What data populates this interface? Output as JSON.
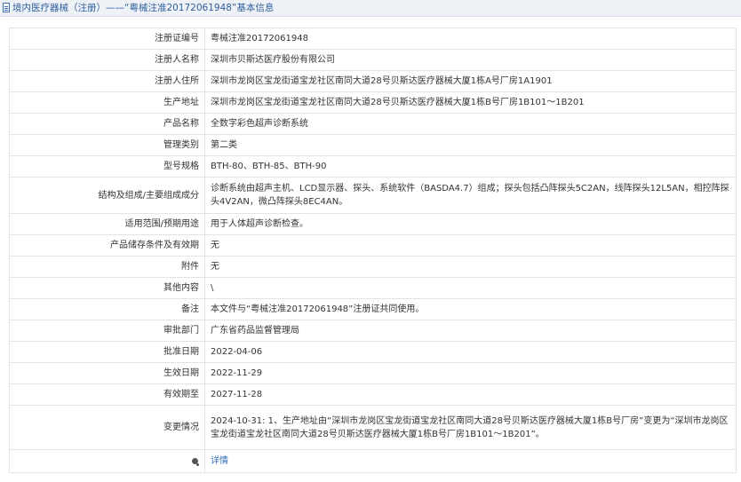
{
  "header": {
    "title": "境内医疗器械（注册）——“粤械注准20172061948”基本信息"
  },
  "rows": [
    {
      "label": "注册证编号",
      "value": "粤械注准20172061948"
    },
    {
      "label": "注册人名称",
      "value": "深圳市贝斯达医疗股份有限公司"
    },
    {
      "label": "注册人住所",
      "value": "深圳市龙岗区宝龙街道宝龙社区南同大道28号贝斯达医疗器械大厦1栋A号厂房1A1901"
    },
    {
      "label": "生产地址",
      "value": "深圳市龙岗区宝龙街道宝龙社区南同大道28号贝斯达医疗器械大厦1栋B号厂房1B101～1B201"
    },
    {
      "label": "产品名称",
      "value": "全数字彩色超声诊断系统"
    },
    {
      "label": "管理类别",
      "value": "第二类"
    },
    {
      "label": "型号规格",
      "value": "BTH-80、BTH-85、BTH-90"
    },
    {
      "label": "结构及组成/主要组成成分",
      "value": "诊断系统由超声主机、LCD显示器、探头、系统软件（BASDA4.7）组成；探头包括凸阵探头5C2AN，线阵探头12L5AN，相控阵探头4V2AN，微凸阵探头8EC4AN。"
    },
    {
      "label": "适用范围/预期用途",
      "value": "用于人体超声诊断检查。"
    },
    {
      "label": "产品储存条件及有效期",
      "value": "无"
    },
    {
      "label": "附件",
      "value": "无"
    },
    {
      "label": "其他内容",
      "value": "\\"
    },
    {
      "label": "备注",
      "value": "本文件与“粤械注准20172061948”注册证共同使用。"
    },
    {
      "label": "审批部门",
      "value": "广东省药品监督管理局"
    },
    {
      "label": "批准日期",
      "value": "2022-04-06"
    },
    {
      "label": "生效日期",
      "value": "2022-11-29"
    },
    {
      "label": "有效期至",
      "value": "2027-11-28"
    },
    {
      "label": "变更情况",
      "value": "2024-10-31: 1、生产地址由“深圳市龙岗区宝龙街道宝龙社区南同大道28号贝斯达医疗器械大厦1栋B号厂房”变更为“深圳市龙岗区宝龙街道宝龙社区南同大道28号贝斯达医疗器械大厦1栋B号厂房1B101～1B201”。"
    }
  ],
  "tip_row": {
    "icon": "tip-icon",
    "link_label": "详情"
  },
  "colors": {
    "header_bg": "#eef1f6",
    "header_text": "#2f5f9e",
    "border": "#e3e3e3",
    "link": "#2f6db5"
  }
}
